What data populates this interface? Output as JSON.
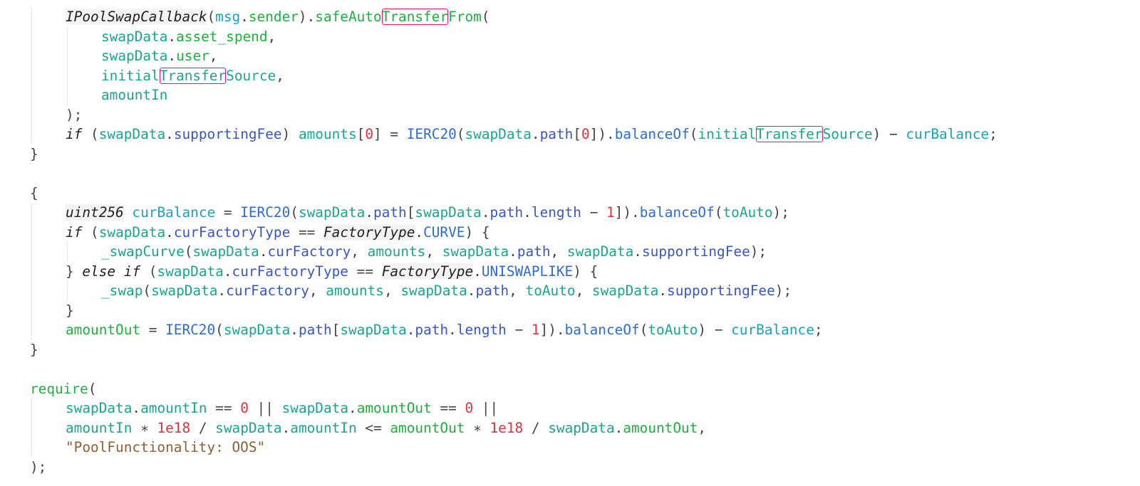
{
  "editor": {
    "colors": {
      "background": "#ffffff",
      "keyword": "#222222",
      "variable": "#17a78d",
      "function_call": "#1db13f",
      "method": "#2f6bd4",
      "property": "#3956c8",
      "number": "#e0323e",
      "string": "#8a6137",
      "highlight_box": "#e6197a"
    },
    "lines": [
      {
        "indent": 1,
        "tokens": [
          {
            "t": "IPoolSwapCallback",
            "c": "type"
          },
          {
            "t": "(",
            "c": "punc"
          },
          {
            "t": "msg",
            "c": "msg"
          },
          {
            "t": ".",
            "c": "punc"
          },
          {
            "t": "sender",
            "c": "green"
          },
          {
            "t": ").",
            "c": "punc"
          },
          {
            "t": "safeAuto",
            "c": "green"
          },
          {
            "t": "Transfer",
            "c": "green",
            "hl": true
          },
          {
            "t": "From",
            "c": "green"
          },
          {
            "t": "(",
            "c": "punc"
          }
        ]
      },
      {
        "indent": 2,
        "tokens": [
          {
            "t": "swapData",
            "c": "var"
          },
          {
            "t": ".",
            "c": "punc"
          },
          {
            "t": "asset_spend",
            "c": "green"
          },
          {
            "t": ",",
            "c": "punc"
          }
        ]
      },
      {
        "indent": 2,
        "tokens": [
          {
            "t": "swapData",
            "c": "var"
          },
          {
            "t": ".",
            "c": "punc"
          },
          {
            "t": "user",
            "c": "green"
          },
          {
            "t": ",",
            "c": "punc"
          }
        ]
      },
      {
        "indent": 2,
        "tokens": [
          {
            "t": "initial",
            "c": "var"
          },
          {
            "t": "Transfer",
            "c": "var",
            "hl": true
          },
          {
            "t": "Source",
            "c": "var"
          },
          {
            "t": ",",
            "c": "punc"
          }
        ]
      },
      {
        "indent": 2,
        "tokens": [
          {
            "t": "amountIn",
            "c": "var"
          }
        ]
      },
      {
        "indent": 1,
        "tokens": [
          {
            "t": ");",
            "c": "punc"
          }
        ]
      },
      {
        "indent": 1,
        "tokens": [
          {
            "t": "if",
            "c": "kw"
          },
          {
            "t": " (",
            "c": "punc"
          },
          {
            "t": "swapData",
            "c": "var"
          },
          {
            "t": ".",
            "c": "punc"
          },
          {
            "t": "supportingFee",
            "c": "prop"
          },
          {
            "t": ") ",
            "c": "punc"
          },
          {
            "t": "amounts",
            "c": "var"
          },
          {
            "t": "[",
            "c": "punc"
          },
          {
            "t": "0",
            "c": "num"
          },
          {
            "t": "] = ",
            "c": "punc"
          },
          {
            "t": "IERC20",
            "c": "method"
          },
          {
            "t": "(",
            "c": "punc"
          },
          {
            "t": "swapData",
            "c": "var"
          },
          {
            "t": ".",
            "c": "punc"
          },
          {
            "t": "path",
            "c": "prop"
          },
          {
            "t": "[",
            "c": "punc"
          },
          {
            "t": "0",
            "c": "num"
          },
          {
            "t": "]).",
            "c": "punc"
          },
          {
            "t": "balanceOf",
            "c": "method"
          },
          {
            "t": "(",
            "c": "punc"
          },
          {
            "t": "initial",
            "c": "var"
          },
          {
            "t": "Transfer",
            "c": "var",
            "hl": true
          },
          {
            "t": "Source",
            "c": "var"
          },
          {
            "t": ") − ",
            "c": "punc"
          },
          {
            "t": "curBalance",
            "c": "msg"
          },
          {
            "t": ";",
            "c": "punc"
          }
        ]
      },
      {
        "indent": 0,
        "tokens": [
          {
            "t": "}",
            "c": "punc"
          }
        ]
      },
      {
        "indent": 0,
        "tokens": []
      },
      {
        "indent": 0,
        "tokens": [
          {
            "t": "{",
            "c": "punc"
          }
        ]
      },
      {
        "indent": 1,
        "tokens": [
          {
            "t": "uint256",
            "c": "type"
          },
          {
            "t": " ",
            "c": "punc"
          },
          {
            "t": "curBalance",
            "c": "msg"
          },
          {
            "t": " = ",
            "c": "punc"
          },
          {
            "t": "IERC20",
            "c": "method"
          },
          {
            "t": "(",
            "c": "punc"
          },
          {
            "t": "swapData",
            "c": "var"
          },
          {
            "t": ".",
            "c": "punc"
          },
          {
            "t": "path",
            "c": "prop"
          },
          {
            "t": "[",
            "c": "punc"
          },
          {
            "t": "swapData",
            "c": "var"
          },
          {
            "t": ".",
            "c": "punc"
          },
          {
            "t": "path",
            "c": "prop"
          },
          {
            "t": ".",
            "c": "punc"
          },
          {
            "t": "length",
            "c": "prop"
          },
          {
            "t": " − ",
            "c": "punc"
          },
          {
            "t": "1",
            "c": "num"
          },
          {
            "t": "]).",
            "c": "punc"
          },
          {
            "t": "balanceOf",
            "c": "method"
          },
          {
            "t": "(",
            "c": "punc"
          },
          {
            "t": "toAuto",
            "c": "var"
          },
          {
            "t": ");",
            "c": "punc"
          }
        ]
      },
      {
        "indent": 1,
        "tokens": [
          {
            "t": "if",
            "c": "kw"
          },
          {
            "t": " (",
            "c": "punc"
          },
          {
            "t": "swapData",
            "c": "var"
          },
          {
            "t": ".",
            "c": "punc"
          },
          {
            "t": "curFactoryType",
            "c": "prop"
          },
          {
            "t": " == ",
            "c": "punc"
          },
          {
            "t": "FactoryType",
            "c": "type"
          },
          {
            "t": ".",
            "c": "punc"
          },
          {
            "t": "CURVE",
            "c": "method"
          },
          {
            "t": ") {",
            "c": "punc"
          }
        ]
      },
      {
        "indent": 2,
        "tokens": [
          {
            "t": "_swapCurve",
            "c": "var"
          },
          {
            "t": "(",
            "c": "punc"
          },
          {
            "t": "swapData",
            "c": "var"
          },
          {
            "t": ".",
            "c": "punc"
          },
          {
            "t": "curFactory",
            "c": "prop"
          },
          {
            "t": ", ",
            "c": "punc"
          },
          {
            "t": "amounts",
            "c": "var"
          },
          {
            "t": ", ",
            "c": "punc"
          },
          {
            "t": "swapData",
            "c": "var"
          },
          {
            "t": ".",
            "c": "punc"
          },
          {
            "t": "path",
            "c": "prop"
          },
          {
            "t": ", ",
            "c": "punc"
          },
          {
            "t": "swapData",
            "c": "var"
          },
          {
            "t": ".",
            "c": "punc"
          },
          {
            "t": "supportingFee",
            "c": "prop"
          },
          {
            "t": ");",
            "c": "punc"
          }
        ]
      },
      {
        "indent": 1,
        "tokens": [
          {
            "t": "} ",
            "c": "punc"
          },
          {
            "t": "else if",
            "c": "kw"
          },
          {
            "t": " (",
            "c": "punc"
          },
          {
            "t": "swapData",
            "c": "var"
          },
          {
            "t": ".",
            "c": "punc"
          },
          {
            "t": "curFactoryType",
            "c": "prop"
          },
          {
            "t": " == ",
            "c": "punc"
          },
          {
            "t": "FactoryType",
            "c": "type"
          },
          {
            "t": ".",
            "c": "punc"
          },
          {
            "t": "UNISWAPLIKE",
            "c": "method"
          },
          {
            "t": ") {",
            "c": "punc"
          }
        ]
      },
      {
        "indent": 2,
        "tokens": [
          {
            "t": "_swap",
            "c": "var"
          },
          {
            "t": "(",
            "c": "punc"
          },
          {
            "t": "swapData",
            "c": "var"
          },
          {
            "t": ".",
            "c": "punc"
          },
          {
            "t": "curFactory",
            "c": "prop"
          },
          {
            "t": ", ",
            "c": "punc"
          },
          {
            "t": "amounts",
            "c": "var"
          },
          {
            "t": ", ",
            "c": "punc"
          },
          {
            "t": "swapData",
            "c": "var"
          },
          {
            "t": ".",
            "c": "punc"
          },
          {
            "t": "path",
            "c": "prop"
          },
          {
            "t": ", ",
            "c": "punc"
          },
          {
            "t": "toAuto",
            "c": "var"
          },
          {
            "t": ", ",
            "c": "punc"
          },
          {
            "t": "swapData",
            "c": "var"
          },
          {
            "t": ".",
            "c": "punc"
          },
          {
            "t": "supportingFee",
            "c": "prop"
          },
          {
            "t": ");",
            "c": "punc"
          }
        ]
      },
      {
        "indent": 1,
        "tokens": [
          {
            "t": "}",
            "c": "punc"
          }
        ]
      },
      {
        "indent": 1,
        "tokens": [
          {
            "t": "amountOut",
            "c": "green"
          },
          {
            "t": " = ",
            "c": "punc"
          },
          {
            "t": "IERC20",
            "c": "method"
          },
          {
            "t": "(",
            "c": "punc"
          },
          {
            "t": "swapData",
            "c": "var"
          },
          {
            "t": ".",
            "c": "punc"
          },
          {
            "t": "path",
            "c": "prop"
          },
          {
            "t": "[",
            "c": "punc"
          },
          {
            "t": "swapData",
            "c": "var"
          },
          {
            "t": ".",
            "c": "punc"
          },
          {
            "t": "path",
            "c": "prop"
          },
          {
            "t": ".",
            "c": "punc"
          },
          {
            "t": "length",
            "c": "prop"
          },
          {
            "t": " − ",
            "c": "punc"
          },
          {
            "t": "1",
            "c": "num"
          },
          {
            "t": "]).",
            "c": "punc"
          },
          {
            "t": "balanceOf",
            "c": "method"
          },
          {
            "t": "(",
            "c": "punc"
          },
          {
            "t": "toAuto",
            "c": "var"
          },
          {
            "t": ") − ",
            "c": "punc"
          },
          {
            "t": "curBalance",
            "c": "msg"
          },
          {
            "t": ";",
            "c": "punc"
          }
        ]
      },
      {
        "indent": 0,
        "tokens": [
          {
            "t": "}",
            "c": "punc"
          }
        ]
      },
      {
        "indent": 0,
        "tokens": []
      },
      {
        "indent": 0,
        "tokens": [
          {
            "t": "require",
            "c": "green"
          },
          {
            "t": "(",
            "c": "punc"
          }
        ]
      },
      {
        "indent": 1,
        "tokens": [
          {
            "t": "swapData",
            "c": "var"
          },
          {
            "t": ".",
            "c": "punc"
          },
          {
            "t": "amountIn",
            "c": "var"
          },
          {
            "t": " == ",
            "c": "punc"
          },
          {
            "t": "0",
            "c": "num"
          },
          {
            "t": " || ",
            "c": "punc"
          },
          {
            "t": "swapData",
            "c": "var"
          },
          {
            "t": ".",
            "c": "punc"
          },
          {
            "t": "amountOut",
            "c": "green"
          },
          {
            "t": " == ",
            "c": "punc"
          },
          {
            "t": "0",
            "c": "num"
          },
          {
            "t": " ||",
            "c": "punc"
          }
        ]
      },
      {
        "indent": 1,
        "tokens": [
          {
            "t": "amountIn",
            "c": "var"
          },
          {
            "t": " ∗ ",
            "c": "punc"
          },
          {
            "t": "1e18",
            "c": "num"
          },
          {
            "t": " / ",
            "c": "punc"
          },
          {
            "t": "swapData",
            "c": "var"
          },
          {
            "t": ".",
            "c": "punc"
          },
          {
            "t": "amountIn",
            "c": "var"
          },
          {
            "t": " <= ",
            "c": "punc"
          },
          {
            "t": "amountOut",
            "c": "green"
          },
          {
            "t": " ∗ ",
            "c": "punc"
          },
          {
            "t": "1e18",
            "c": "num"
          },
          {
            "t": " / ",
            "c": "punc"
          },
          {
            "t": "swapData",
            "c": "var"
          },
          {
            "t": ".",
            "c": "punc"
          },
          {
            "t": "amountOut",
            "c": "green"
          },
          {
            "t": ",",
            "c": "punc"
          }
        ]
      },
      {
        "indent": 1,
        "tokens": [
          {
            "t": "\"PoolFunctionality: OOS\"",
            "c": "str"
          }
        ]
      },
      {
        "indent": 0,
        "tokens": [
          {
            "t": ");",
            "c": "punc"
          }
        ]
      }
    ]
  }
}
